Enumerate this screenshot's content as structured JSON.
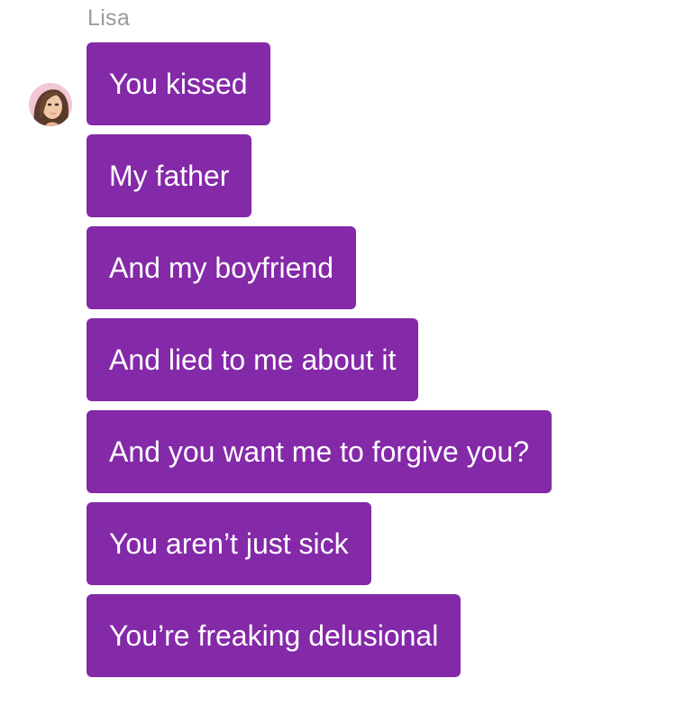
{
  "chat": {
    "sender_name": "Lisa",
    "avatar": {
      "icon": "profile-avatar-icon"
    },
    "bubble_color": "#8429a8",
    "messages": [
      {
        "text": "You kissed"
      },
      {
        "text": "My father"
      },
      {
        "text": "And my boyfriend"
      },
      {
        "text": "And lied to me about it"
      },
      {
        "text": "And you want me to forgive you?"
      },
      {
        "text": "You aren’t just sick"
      },
      {
        "text": "You’re freaking delusional"
      }
    ]
  }
}
